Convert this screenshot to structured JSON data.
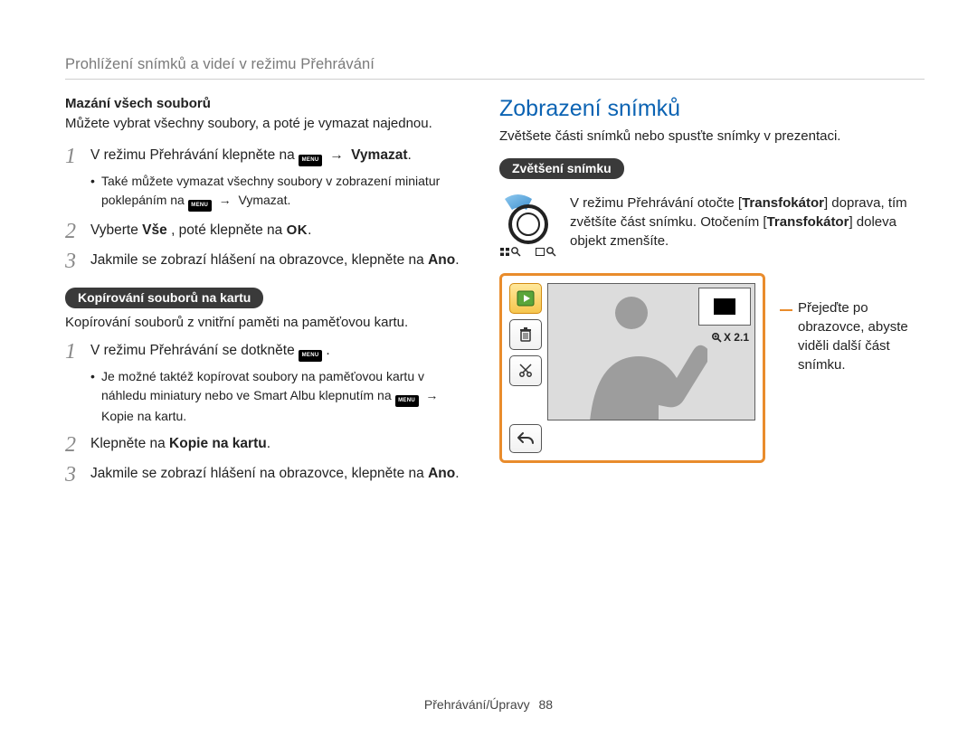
{
  "breadcrumb": "Prohlížení snímků a videí v režimu Přehrávání",
  "left": {
    "delete_all_heading": "Mazání všech souborů",
    "delete_all_intro": "Můžete vybrat všechny soubory, a poté je vymazat najednou.",
    "steps_delete": [
      {
        "n": "1",
        "pre": "V režimu Přehrávání klepněte na ",
        "menu": "MENU",
        "arrow": "→",
        "post_bold": "Vymazat",
        "tail": ".",
        "bullets": [
          {
            "pre": "Také můžete vymazat všechny soubory v zobrazení miniatur poklepáním na ",
            "menu": "MENU",
            "arrow": "→",
            "post_bold": "Vymazat",
            "tail": "."
          }
        ]
      },
      {
        "n": "2",
        "pre": "Vyberte ",
        "bold1": "Vše",
        "mid": ", poté klepněte na ",
        "ok": "OK",
        "tail": "."
      },
      {
        "n": "3",
        "text": "Jakmile se zobrazí hlášení na obrazovce, klepněte na ",
        "bold_tail": "Ano",
        "tail": "."
      }
    ],
    "copy_pill": "Kopírování souborů na kartu",
    "copy_intro": "Kopírování souborů z vnitřní paměti na paměťovou kartu.",
    "steps_copy": [
      {
        "n": "1",
        "pre": "V režimu Přehrávání se dotkněte ",
        "menu": "MENU",
        "tail": ".",
        "bullets": [
          {
            "pre": "Je možné taktéž kopírovat soubory na paměťovou kartu v náhledu miniatury nebo ve Smart Albu klepnutím na ",
            "menu": "MENU",
            "arrow": "→",
            "post_bold": "Kopie na kartu",
            "tail": "."
          }
        ]
      },
      {
        "n": "2",
        "pre": "Klepněte na ",
        "bold1": "Kopie na kartu",
        "tail": "."
      },
      {
        "n": "3",
        "text": "Jakmile se zobrazí hlášení na obrazovce, klepněte na ",
        "bold_tail": "Ano",
        "tail": "."
      }
    ]
  },
  "right": {
    "heading": "Zobrazení snímků",
    "intro": "Zvětšete části snímků nebo spusťte snímky v prezentaci.",
    "zoom_pill": "Zvětšení snímku",
    "zoom_text_pre": "V režimu Přehrávání otočte [",
    "zoom_bold1": "Transfokátor",
    "zoom_text_mid": "] doprava, tím zvětšíte část snímku. Otočením [",
    "zoom_bold2": "Transfokátor",
    "zoom_text_post": "] doleva objekt zmenšíte.",
    "zoom_value": "X 2.1",
    "callout": "Přejeďte po obrazovce, abyste viděli další část snímku."
  },
  "footer": {
    "section": "Přehrávání/Úpravy",
    "page": "88"
  }
}
